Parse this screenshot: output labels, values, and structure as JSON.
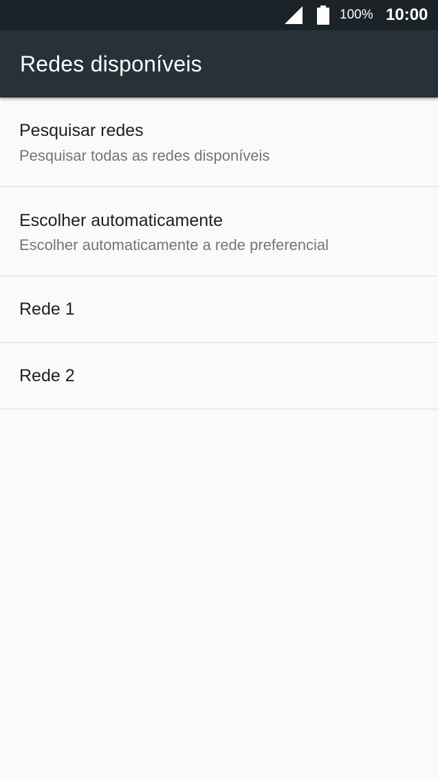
{
  "status_bar": {
    "battery_percent": "100%",
    "time": "10:00",
    "signal_icon": "signal-icon",
    "battery_icon": "battery-icon"
  },
  "app_bar": {
    "title": "Redes disponíveis"
  },
  "list": {
    "items": [
      {
        "title": "Pesquisar redes",
        "summary": "Pesquisar todas as redes disponíveis"
      },
      {
        "title": "Escolher automaticamente",
        "summary": "Escolher automaticamente a rede preferencial"
      },
      {
        "title": "Rede 1"
      },
      {
        "title": "Rede 2"
      }
    ]
  },
  "colors": {
    "status_bar": "#1b2329",
    "app_bar": "#263238",
    "background": "#fafafa",
    "divider": "#d9d9d9",
    "title_text": "#212121",
    "summary_text": "#757575"
  }
}
